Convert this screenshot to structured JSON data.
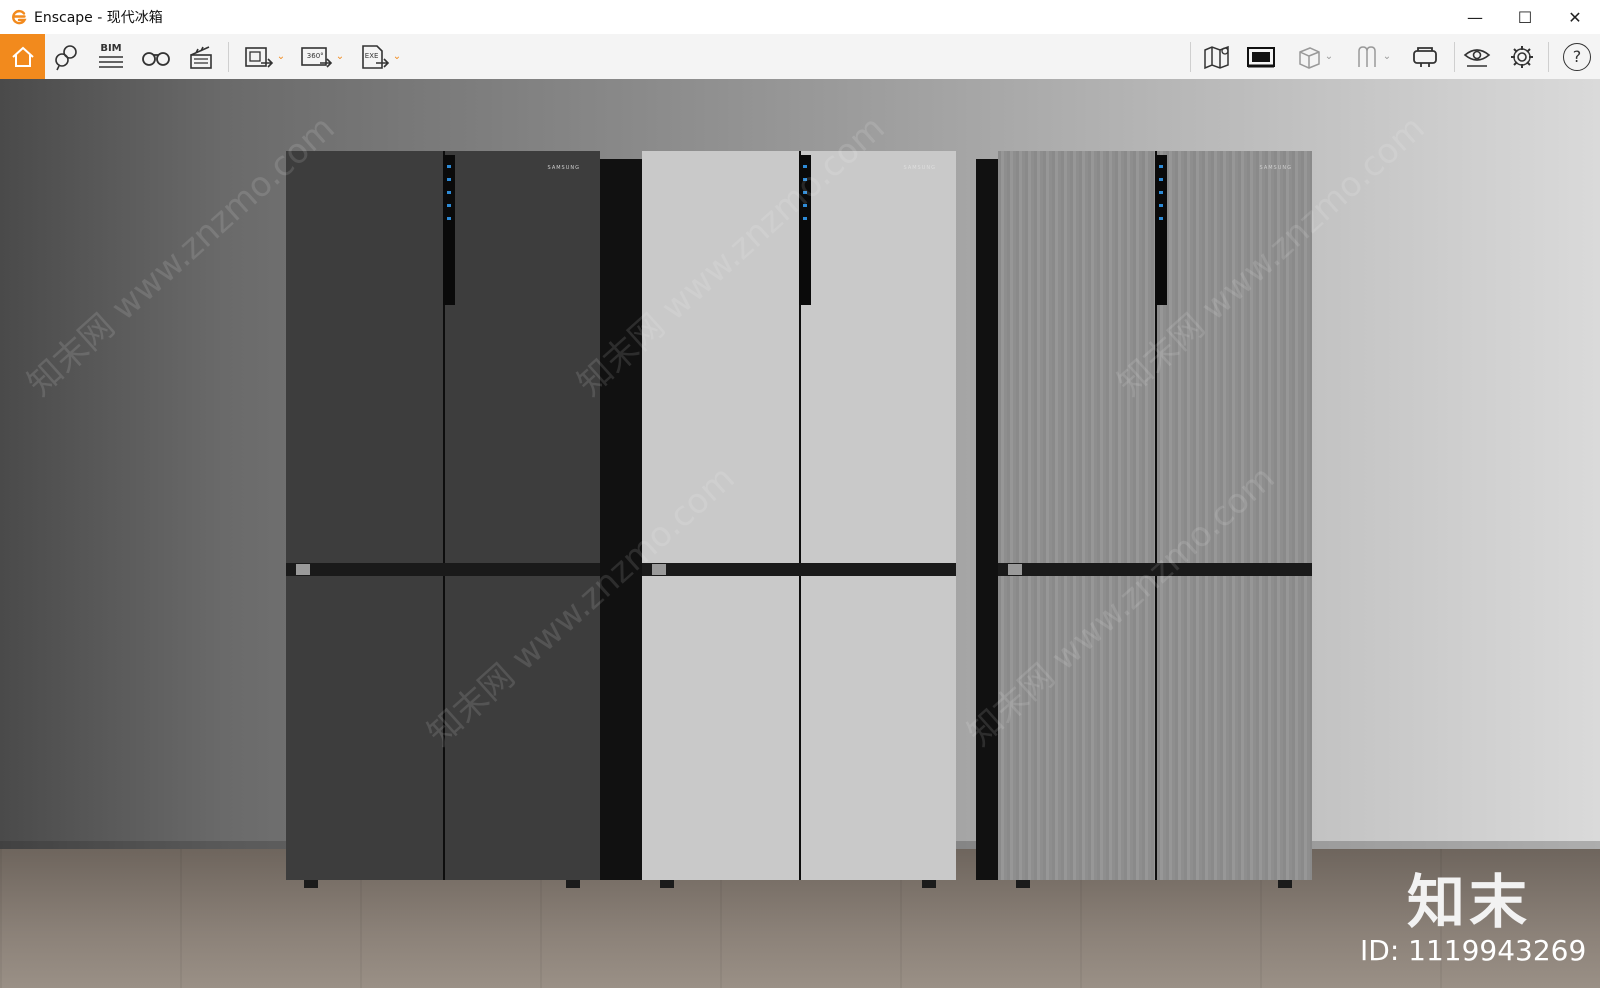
{
  "window": {
    "title": "Enscape - 现代冰箱",
    "controls": {
      "minimize": "—",
      "maximize": "☐",
      "close": "✕"
    }
  },
  "toolbar": {
    "accent_color": "#f28a1d",
    "left_tools": [
      {
        "icon": "home-icon"
      },
      {
        "icon": "views-pin-icon"
      },
      {
        "icon": "bim-icon",
        "label": "BIM"
      },
      {
        "icon": "binoculars-icon"
      },
      {
        "icon": "clapperboard-icon"
      },
      {
        "icon": "screenshot-export-icon",
        "dropdown": true
      },
      {
        "icon": "panorama-export-icon",
        "label": "360°",
        "dropdown": true
      },
      {
        "icon": "exe-export-icon",
        "label": "EXE",
        "dropdown": true
      }
    ],
    "right_tools": [
      {
        "icon": "map-icon"
      },
      {
        "icon": "asset-library-icon"
      },
      {
        "icon": "cube-icon",
        "dropdown": true
      },
      {
        "icon": "section-icon",
        "dropdown": true
      },
      {
        "icon": "vr-headset-icon"
      },
      {
        "icon": "eye-icon"
      },
      {
        "icon": "gear-icon"
      },
      {
        "icon": "help-icon",
        "label": "?"
      }
    ],
    "collapse_icon": "chevron-up-icon"
  },
  "scene": {
    "fridges": [
      {
        "brand": "SAMSUNG",
        "finish": "dark gray"
      },
      {
        "brand": "SAMSUNG",
        "finish": "light gray"
      },
      {
        "brand": "SAMSUNG",
        "finish": "brushed steel"
      }
    ],
    "watermark_text": "知末网 www.znzmo.com",
    "brand_mark": "知末",
    "image_id": "ID: 1119943269"
  }
}
